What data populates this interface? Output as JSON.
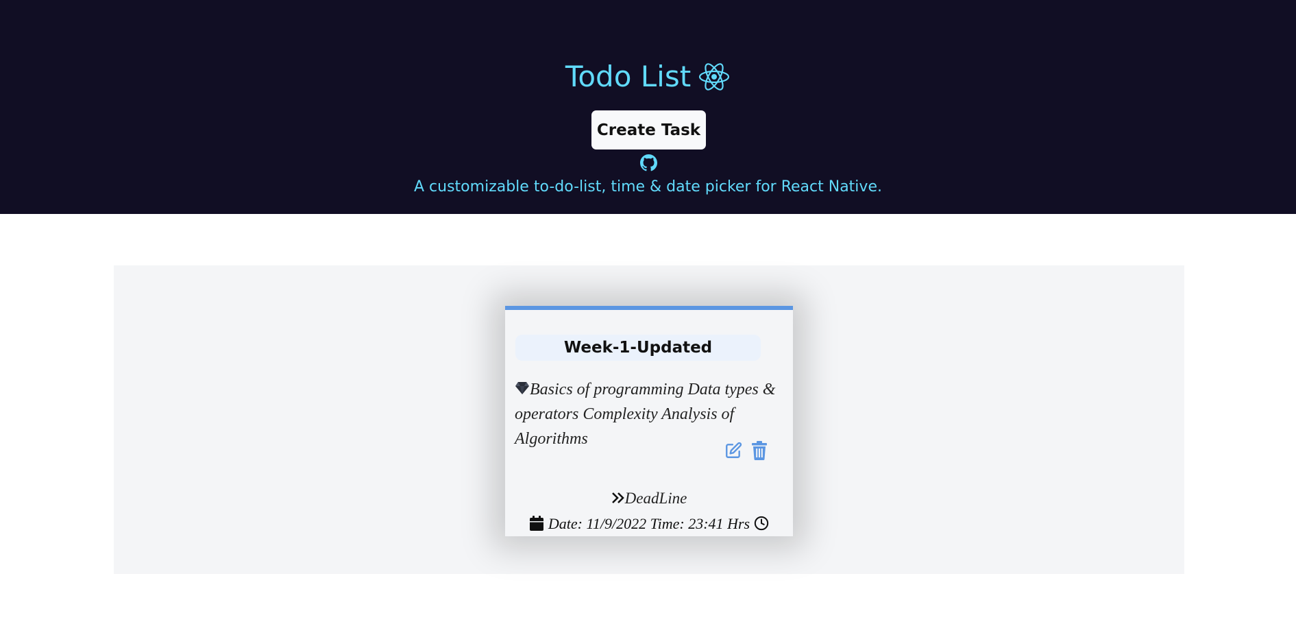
{
  "header": {
    "title": "Todo List",
    "title_icon": "react-atom-icon",
    "create_button_label": "Create Task",
    "github_icon": "github-icon",
    "tagline": "A customizable to-do-list, time & date picker for React Native."
  },
  "card": {
    "title": "Week-1-Updated",
    "description": "Basics of programming Data types & operators Complexity Analysis of Algorithms",
    "description_icon": "gem-icon",
    "deadline_label": "DeadLine",
    "date_label": "Date:",
    "date_value": "11/9/2022",
    "time_label": "Time:",
    "time_value": "23:41",
    "time_unit": "Hrs"
  },
  "colors": {
    "header_bg": "#110e24",
    "accent": "#61dafb",
    "card_border": "#5b96e2",
    "icon_blue": "#5b96e2"
  }
}
